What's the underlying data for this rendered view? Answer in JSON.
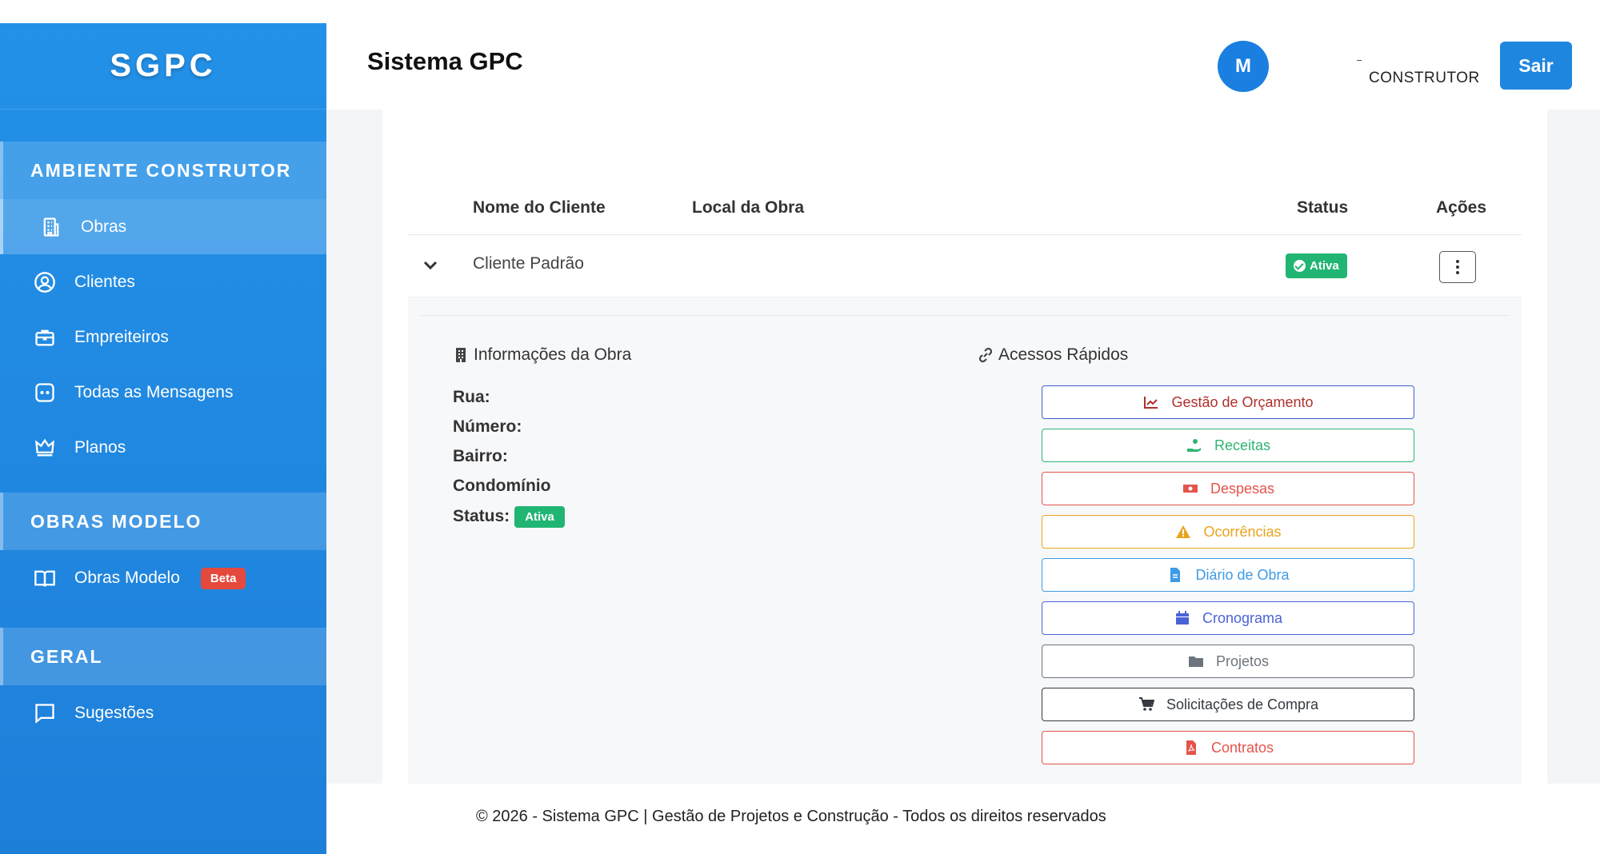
{
  "brand": "SGPC",
  "header": {
    "title": "Sistema GPC",
    "avatar_initial": "M",
    "role": "CONSTRUTOR",
    "logout_label": "Sair"
  },
  "sidebar": {
    "sections": [
      {
        "title": "AMBIENTE CONSTRUTOR"
      },
      {
        "title": "OBRAS MODELO"
      },
      {
        "title": "GERAL"
      }
    ],
    "items": [
      {
        "label": "Obras",
        "icon": "building-icon"
      },
      {
        "label": "Clientes",
        "icon": "user-circle-icon"
      },
      {
        "label": "Empreiteiros",
        "icon": "briefcase-icon"
      },
      {
        "label": "Todas as Mensagens",
        "icon": "message-dots-icon"
      },
      {
        "label": "Planos",
        "icon": "crown-icon"
      },
      {
        "label": "Obras Modelo",
        "icon": "book-icon",
        "badge": "Beta"
      },
      {
        "label": "Sugestões",
        "icon": "comment-icon"
      }
    ]
  },
  "table": {
    "columns": [
      "Nome do Cliente",
      "Local da Obra",
      "Status",
      "Ações"
    ],
    "rows": [
      {
        "client": "Cliente Padrão",
        "location": "",
        "status": "Ativa"
      }
    ]
  },
  "details": {
    "info_title": "Informações da Obra",
    "fields": [
      {
        "label": "Rua:"
      },
      {
        "label": "Número:"
      },
      {
        "label": "Bairro:"
      },
      {
        "label": "Condomínio"
      },
      {
        "label": "Status:",
        "badge": "Ativa"
      }
    ],
    "quick_title": "Acessos Rápidos",
    "quick_links": [
      {
        "label": "Gestão de Orçamento",
        "color": "#b0302c",
        "border": "#3b5fc9",
        "icon": "chart-line-icon"
      },
      {
        "label": "Receitas",
        "color": "#2fb573",
        "border": "#2fb573",
        "icon": "hand-money-icon"
      },
      {
        "label": "Despesas",
        "color": "#e5534b",
        "border": "#e5534b",
        "icon": "money-bill-icon"
      },
      {
        "label": "Ocorrências",
        "color": "#e9a41f",
        "border": "#e9a41f",
        "icon": "warning-icon"
      },
      {
        "label": "Diário de Obra",
        "color": "#3e9be6",
        "border": "#3e9be6",
        "icon": "file-icon"
      },
      {
        "label": "Cronograma",
        "color": "#4a63d6",
        "border": "#4a63d6",
        "icon": "calendar-icon"
      },
      {
        "label": "Projetos",
        "color": "#6c757d",
        "border": "#6c757d",
        "icon": "folder-icon"
      },
      {
        "label": "Solicitações de Compra",
        "color": "#343a40",
        "border": "#343a40",
        "icon": "cart-icon"
      },
      {
        "label": "Contratos",
        "color": "#e5534b",
        "border": "#e5534b",
        "icon": "pdf-file-icon"
      }
    ]
  },
  "footer": "© 2026 - Sistema GPC | Gestão de Projetos e Construção - Todos os direitos reservados",
  "colors": {
    "sidebar": "#1f86e0",
    "primary": "#1f86e0",
    "success": "#21b573"
  }
}
